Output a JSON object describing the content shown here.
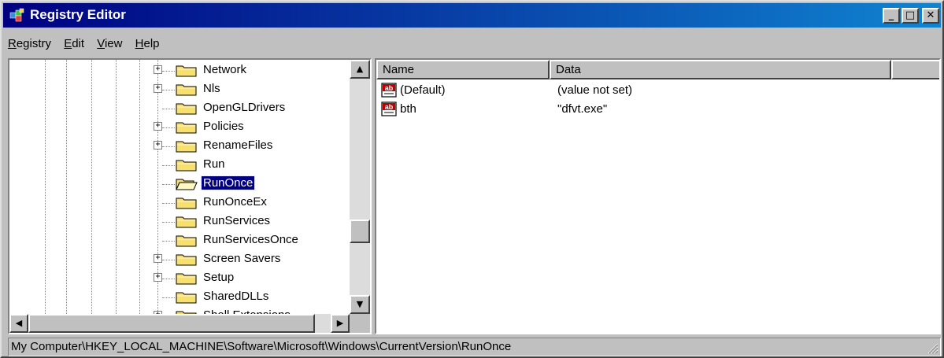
{
  "window": {
    "title": "Registry Editor",
    "icon": "registry-editor-icon"
  },
  "title_buttons": {
    "minimize": "_",
    "maximize": "□",
    "close": "✕"
  },
  "menu": [
    {
      "label": "Registry",
      "key": "R",
      "rest": "egistry"
    },
    {
      "label": "Edit",
      "key": "E",
      "rest": "dit"
    },
    {
      "label": "View",
      "key": "V",
      "rest": "iew"
    },
    {
      "label": "Help",
      "key": "H",
      "rest": "elp"
    }
  ],
  "tree": {
    "selected": "RunOnce",
    "items": [
      {
        "label": "Network",
        "expandable": true,
        "expander": "+"
      },
      {
        "label": "Nls",
        "expandable": true,
        "expander": "+"
      },
      {
        "label": "OpenGLDrivers",
        "expandable": false
      },
      {
        "label": "Policies",
        "expandable": true,
        "expander": "+"
      },
      {
        "label": "RenameFiles",
        "expandable": true,
        "expander": "+"
      },
      {
        "label": "Run",
        "expandable": false
      },
      {
        "label": "RunOnce",
        "expandable": false,
        "selected": true,
        "open": true
      },
      {
        "label": "RunOnceEx",
        "expandable": false
      },
      {
        "label": "RunServices",
        "expandable": false
      },
      {
        "label": "RunServicesOnce",
        "expandable": false
      },
      {
        "label": "Screen Savers",
        "expandable": true,
        "expander": "+"
      },
      {
        "label": "Setup",
        "expandable": true,
        "expander": "+"
      },
      {
        "label": "SharedDLLs",
        "expandable": false
      },
      {
        "label": "Shell Extensions",
        "expandable": true,
        "expander": "+"
      }
    ]
  },
  "scroll_arrows": {
    "up": "▲",
    "down": "▼",
    "left": "◀",
    "right": "▶"
  },
  "list": {
    "columns": [
      "Name",
      "Data"
    ],
    "rows": [
      {
        "name": "(Default)",
        "data": "(value not set)",
        "icon": "string-value-icon",
        "icon_text": "ab"
      },
      {
        "name": "bth",
        "data": "\"dfvt.exe\"",
        "icon": "string-value-icon",
        "icon_text": "ab"
      }
    ]
  },
  "status": {
    "path": "My Computer\\HKEY_LOCAL_MACHINE\\Software\\Microsoft\\Windows\\CurrentVersion\\RunOnce"
  },
  "colors": {
    "titlebar_start": "#000080",
    "titlebar_end": "#1084d0",
    "face": "#c0c0c0",
    "folder": "#f8e070",
    "selection": "#000080"
  }
}
